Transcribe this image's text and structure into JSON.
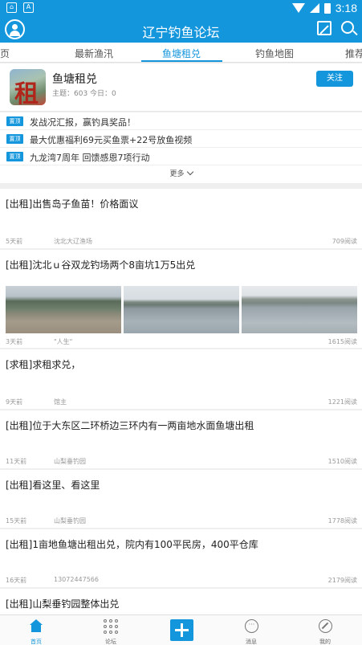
{
  "status_bar": {
    "time": "3:18"
  },
  "app": {
    "title": "辽宁钓鱼论坛"
  },
  "tabs": [
    {
      "label": "页"
    },
    {
      "label": "最新渔汛"
    },
    {
      "label": "鱼塘租兑"
    },
    {
      "label": "钓鱼地图"
    },
    {
      "label": "推荐"
    }
  ],
  "forum": {
    "avatar_text": "租",
    "name": "鱼塘租兑",
    "stats": "主题：603 今日：0",
    "follow_label": "关注"
  },
  "pinned": {
    "badge": "置顶",
    "items": [
      "发战况汇报，赢钓具奖品！",
      "最大优惠福利69元买鱼票+22号放鱼视频",
      "九龙湾7周年 回馈感恩7项行动"
    ],
    "more_label": "更多"
  },
  "posts": [
    {
      "title": "[出租]出售岛子鱼苗！价格面议",
      "time": "5天前",
      "author": "沈北大辽渔场",
      "views": "709阅读"
    },
    {
      "title": "[出租]沈北ｕ谷双龙钓场两个8亩坑1万5出兑",
      "time": "3天前",
      "author": "\"人生\"",
      "views": "1615阅读"
    },
    {
      "title": "[求租]求租求兑，",
      "time": "9天前",
      "author": "馆主",
      "views": "1221阅读"
    },
    {
      "title": "[出租]位于大东区二环桥边三环内有一两亩地水面鱼塘出租",
      "time": "11天前",
      "author": "山梨垂钓园",
      "views": "1510阅读"
    },
    {
      "title": "[出租]看这里、看这里",
      "time": "15天前",
      "author": "山梨垂钓园",
      "views": "1778阅读"
    },
    {
      "title": "[出租]1亩地鱼塘出租出兑，院内有100平民房，400平仓库",
      "time": "16天前",
      "author": "13072447566",
      "views": "2179阅读"
    },
    {
      "title": "[出租]山梨垂钓园整体出兑",
      "time": "",
      "author": "",
      "views": ""
    }
  ],
  "bottom_nav": [
    {
      "label": "首页",
      "icon": "home-icon"
    },
    {
      "label": "论坛",
      "icon": "grid-icon"
    },
    {
      "label": "",
      "icon": "plus-icon"
    },
    {
      "label": "消息",
      "icon": "message-icon"
    },
    {
      "label": "我的",
      "icon": "compass-icon"
    }
  ],
  "colors": {
    "primary": "#1496dc",
    "background": "#efefef"
  }
}
